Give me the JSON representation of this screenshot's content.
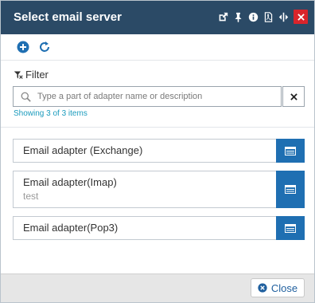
{
  "dialog": {
    "title": "Select email server",
    "title_icons": [
      "external-link-icon",
      "pin-icon",
      "info-icon",
      "pdf-icon",
      "resize-icon"
    ],
    "close_icon": "close-icon"
  },
  "toolbar": {
    "buttons": [
      {
        "icon": "add-icon"
      },
      {
        "icon": "refresh-icon"
      }
    ]
  },
  "filter": {
    "label": "Filter",
    "placeholder": "Type a part of adapter name or description",
    "value": "",
    "showing": "Showing 3 of 3 items"
  },
  "items": [
    {
      "name": "Email adapter (Exchange)",
      "description": ""
    },
    {
      "name": "Email adapter(Imap)",
      "description": "test"
    },
    {
      "name": "Email adapter(Pop3)",
      "description": ""
    }
  ],
  "footer": {
    "close_label": "Close"
  },
  "colors": {
    "titlebar": "#2b4a66",
    "accent": "#1f6fb2",
    "close": "#d9242b",
    "link": "#1a9bbd"
  }
}
